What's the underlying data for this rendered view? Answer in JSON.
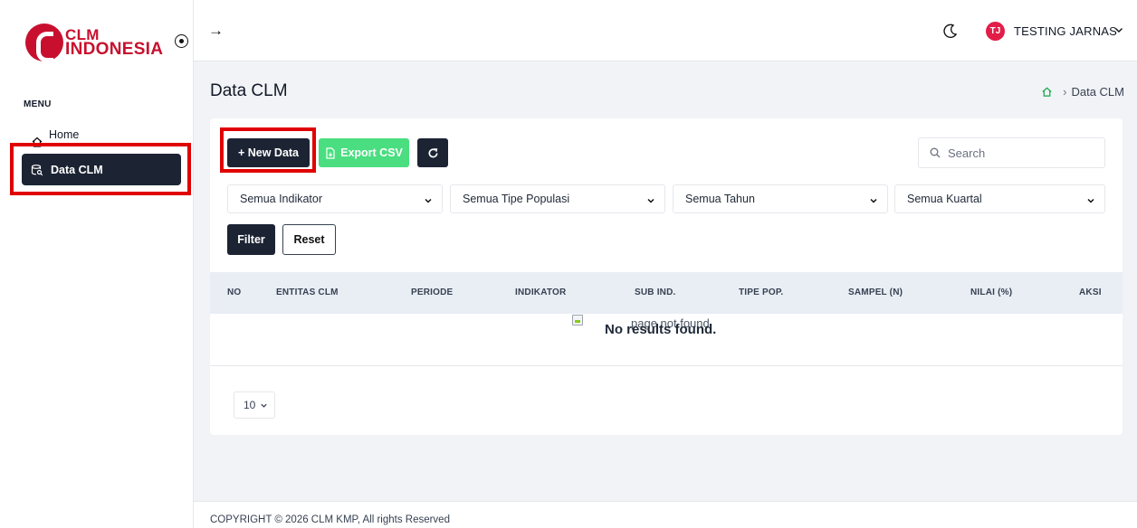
{
  "brand": {
    "line1": "CLM",
    "line2": "INDONESIA",
    "color": "#c8102e"
  },
  "sidebar": {
    "menu_label": "MENU",
    "items": [
      {
        "label": "Home",
        "icon": "home-icon",
        "active": false
      },
      {
        "label": "Data CLM",
        "icon": "database-search-icon",
        "active": true
      }
    ]
  },
  "header": {
    "expand_icon": "→",
    "avatar_initials": "TJ",
    "user_name": "TESTING JARNAS",
    "avatar_color": "#e11d48"
  },
  "page": {
    "title": "Data CLM",
    "breadcrumb_current": "Data CLM"
  },
  "toolbar": {
    "new_label": "+ New Data",
    "export_label": "Export CSV",
    "search_placeholder": "Search"
  },
  "filters": {
    "indikator": "Semua Indikator",
    "tipe_populasi": "Semua Tipe Populasi",
    "tahun": "Semua Tahun",
    "kuartal": "Semua Kuartal",
    "filter_label": "Filter",
    "reset_label": "Reset"
  },
  "table": {
    "columns": [
      "NO",
      "ENTITAS CLM",
      "PERIODE",
      "INDIKATOR",
      "SUB IND.",
      "TIPE POP.",
      "SAMPEL (N)",
      "NILAI (%)",
      "AKSI"
    ],
    "empty_image_alt": "page not found",
    "empty_message": "No results found.",
    "page_size": "10"
  },
  "footer": {
    "text": "COPYRIGHT © 2026 CLM KMP, All rights Reserved"
  },
  "colors": {
    "primary_dark": "#1c2434",
    "export_green": "#4ade80",
    "highlight_red": "#e00000"
  }
}
